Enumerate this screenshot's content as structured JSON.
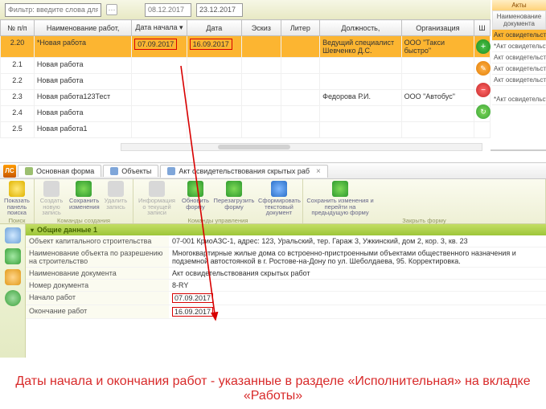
{
  "filter": {
    "placeholder": "Фильтр: введите слова для поиска",
    "dots": "⋯",
    "date1": "08.12.2017",
    "date2": "23.12.2017"
  },
  "table": {
    "headers": {
      "num": "№ п/п",
      "name": "Наименование работ,",
      "start": "Дата начала ▾",
      "date": "Дата",
      "eskiz": "Эскиз",
      "liter": "Литер",
      "position": "Должность,",
      "org": "Организация",
      "sh": "Ш"
    },
    "rows": [
      {
        "num": "2.20",
        "name": "*Новая работа",
        "start": "07.09.2017",
        "date": "16.09.2017",
        "position": "Ведущий специалист Шевченко Д.С.",
        "org": "ООО \"Такси быстро\"",
        "hl": true
      },
      {
        "num": "2.1",
        "name": "Новая работа"
      },
      {
        "num": "2.2",
        "name": "Новая работа"
      },
      {
        "num": "2.3",
        "name": "Новая работа123Тест",
        "position": "Федорова Р.И.",
        "org": "ООО \"Автобус\""
      },
      {
        "num": "2.4",
        "name": "Новая работа"
      },
      {
        "num": "2.5",
        "name": "Новая работа1"
      }
    ]
  },
  "akts": {
    "title": "Акты",
    "header": "Наименование документа",
    "rows": [
      "Акт освидетельствования",
      "*Акт освидетельствования",
      "Акт освидетельствования",
      "Акт освидетельствования",
      "Акт освидетельствования",
      "*Акт освидетельствования"
    ]
  },
  "tabs": {
    "t1": "Основная форма",
    "t2": "Объекты",
    "t3": "Акт освидетельствования скрытых раб",
    "close": "×"
  },
  "ribbon": {
    "search": {
      "show": "Показать панель поиска",
      "group": "Поиск"
    },
    "create": {
      "new": "Создать новую запись",
      "save": "Сохранить изменения",
      "del": "Удалить запись",
      "group": "Команды создания"
    },
    "manage": {
      "info": "Информация о текущей записи",
      "refresh": "Обновить форму",
      "reload": "Перезагрузить форму",
      "doc": "Сформировать текстовый документ",
      "group": "Команды управления"
    },
    "close": {
      "save_back": "Сохранить изменения и перейти на предыдущую форму",
      "group": "Закрыть форму"
    }
  },
  "formhead": {
    "title": "Общие данные 1",
    "chev": "▾"
  },
  "form": {
    "r1": {
      "label": "Объект капитального строительства",
      "value": "07-001 КриоАЗС-1, адрес: 123, Уральский, тер. Гараж 3, Ужкинский, дом 2, кор. 3, кв. 23"
    },
    "r2": {
      "label": "Наименование объекта по разрешению на строительство",
      "value": "Многоквартирные жилые дома со встроенно-пристроенными объектами общественного назначения и подземной автостоянкой в г. Ростове-на-Дону по ул. Шеболдаева, 95. Корректировка."
    },
    "r3": {
      "label": "Наименование документа",
      "value": "Акт освидетельствования скрытых работ"
    },
    "r4": {
      "label": "Номер документа",
      "value": "8-RY"
    },
    "r5": {
      "label": "Начало работ",
      "value": "07.09.2017"
    },
    "r6": {
      "label": "Окончание работ",
      "value": "16.09.2017"
    }
  },
  "caption": "Даты начала и окончания работ  - указанные в разделе «Исполнительная» на вкладке «Работы»"
}
